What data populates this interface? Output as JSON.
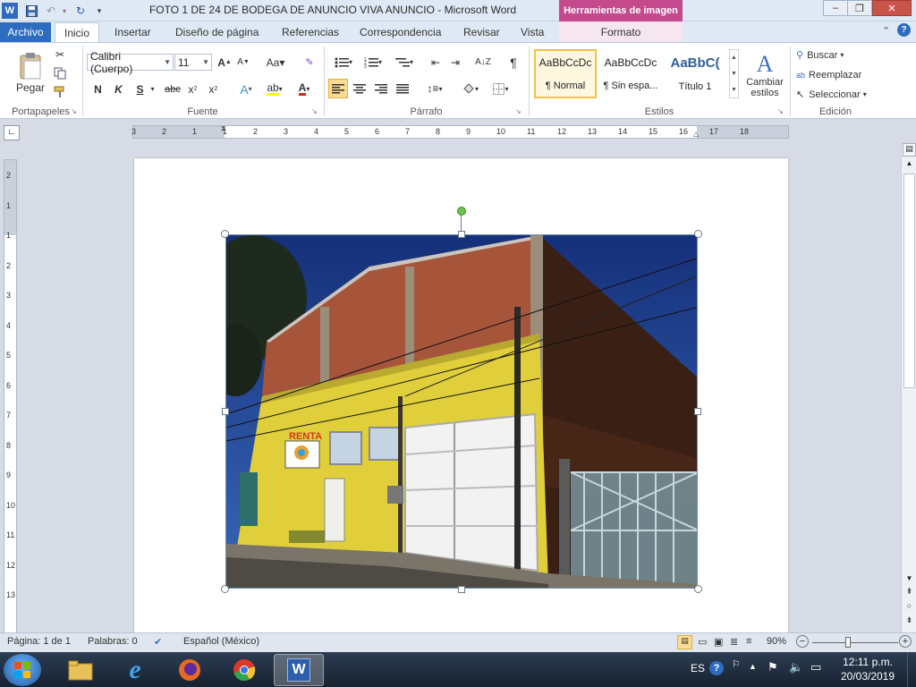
{
  "window": {
    "title": "FOTO 1 DE 24 DE BODEGA DE ANUNCIO VIVA ANUNCIO  -  Microsoft Word",
    "context_tab_header": "Herramientas de imagen"
  },
  "tabs": [
    "Archivo",
    "Inicio",
    "Insertar",
    "Diseño de página",
    "Referencias",
    "Correspondencia",
    "Revisar",
    "Vista",
    "Formato"
  ],
  "ribbon": {
    "clipboard": {
      "paste": "Pegar",
      "label": "Portapapeles"
    },
    "font": {
      "name": "Calibri (Cuerpo)",
      "size": "11",
      "label": "Fuente"
    },
    "paragraph": {
      "label": "Párrafo"
    },
    "styles": {
      "label": "Estilos",
      "tiles": [
        {
          "preview": "AaBbCcDc",
          "name": "¶ Normal"
        },
        {
          "preview": "AaBbCcDc",
          "name": "¶ Sin espa..."
        },
        {
          "preview": "AaBbC(",
          "name": "Título 1"
        }
      ],
      "change_line1": "Cambiar",
      "change_line2": "estilos"
    },
    "editing": {
      "find": "Buscar",
      "replace": "Reemplazar",
      "select": "Seleccionar",
      "label": "Edición"
    }
  },
  "ruler": {
    "h_marks": [
      "3",
      "2",
      "1",
      "1",
      "2",
      "3",
      "4",
      "5",
      "6",
      "7",
      "8",
      "9",
      "10",
      "11",
      "12",
      "13",
      "14",
      "15",
      "16",
      "17",
      "18"
    ],
    "v_marks": [
      "2",
      "1",
      "1",
      "2",
      "3",
      "4",
      "5",
      "6",
      "7",
      "8",
      "9",
      "10",
      "11",
      "12",
      "13"
    ]
  },
  "photo": {
    "sign_text": "RENTA"
  },
  "status": {
    "page": "Página: 1 de 1",
    "words": "Palabras: 0",
    "language": "Español (México)",
    "zoom": "90%"
  },
  "taskbar": {
    "lang": "ES",
    "time": "12:11 p.m.",
    "date": "20/03/2019"
  },
  "colors": {
    "accent": "#2d6cc0",
    "context": "#c4498d",
    "building_yellow": "#e0cf3a",
    "brick": "#a5523a",
    "sky": "#1d3f8f"
  }
}
